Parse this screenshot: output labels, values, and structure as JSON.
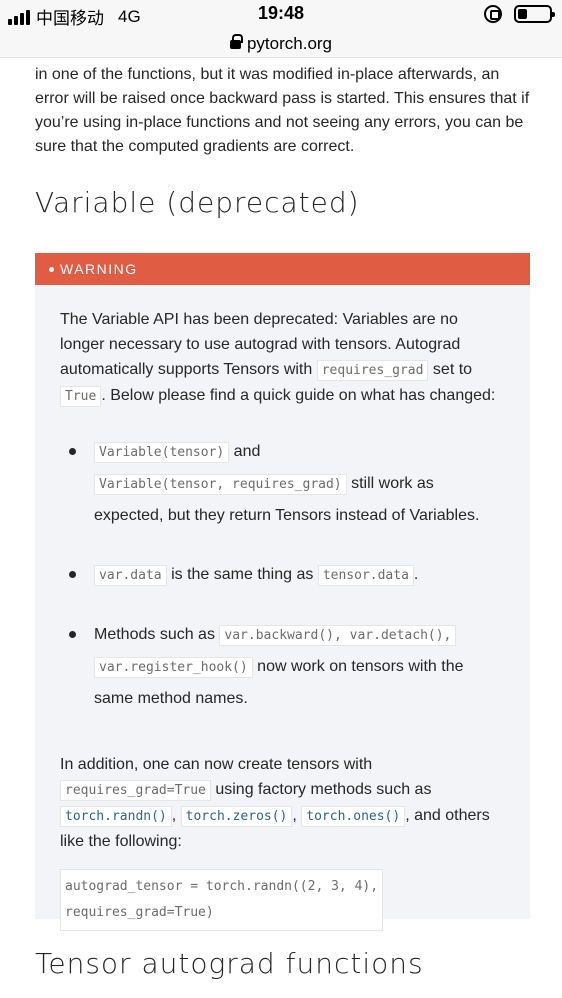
{
  "status_bar": {
    "carrier": "中国移动",
    "network": "4G",
    "time": "19:48",
    "battery_level": 0.3
  },
  "url_bar": {
    "domain": "pytorch.org"
  },
  "intro_paragraph": "in one of the functions, but it was modified in-place afterwards, an error will be raised once backward pass is started. This ensures that if you’re using in-place functions and not seeing any errors, you can be sure that the computed gradients are correct.",
  "section_heading": "Variable (deprecated)",
  "warning": {
    "title": "WARNING",
    "p1_text_a": "The Variable API has been deprecated: Variables are no longer necessary to use autograd with tensors. Autograd automatically supports Tensors with ",
    "p1_code_a": "requires_grad",
    "p1_text_b": " set to ",
    "p1_code_b": "True",
    "p1_text_c": ". Below please find a quick guide on what has changed:",
    "bullets": [
      {
        "code_a": "Variable(tensor)",
        "text_a": " and ",
        "code_b": "Variable(tensor, requires_grad)",
        "text_b": " still work as expected, but they return Tensors instead of Variables."
      },
      {
        "code_a": "var.data",
        "text_a": " is the same thing as ",
        "code_b": "tensor.data",
        "text_b": "."
      },
      {
        "text_pre": "Methods such as ",
        "code_a": "var.backward(), var.detach(),",
        "code_b": "var.register_hook()",
        "text_b": " now work on tensors with the same method names."
      }
    ],
    "p2_text_a": "In addition, one can now create tensors with ",
    "p2_code_a": "requires_grad=True",
    "p2_text_b": " using factory methods such as ",
    "p2_link_1": "torch.randn()",
    "p2_link_2": "torch.zeros()",
    "p2_link_3": "torch.ones()",
    "p2_sep": ", ",
    "p2_text_c": ", and others like the following:",
    "code_block_line1": "autograd_tensor = torch.randn((2, 3, 4),",
    "code_block_line2": "requires_grad=True)"
  },
  "next_heading": "Tensor autograd functions"
}
